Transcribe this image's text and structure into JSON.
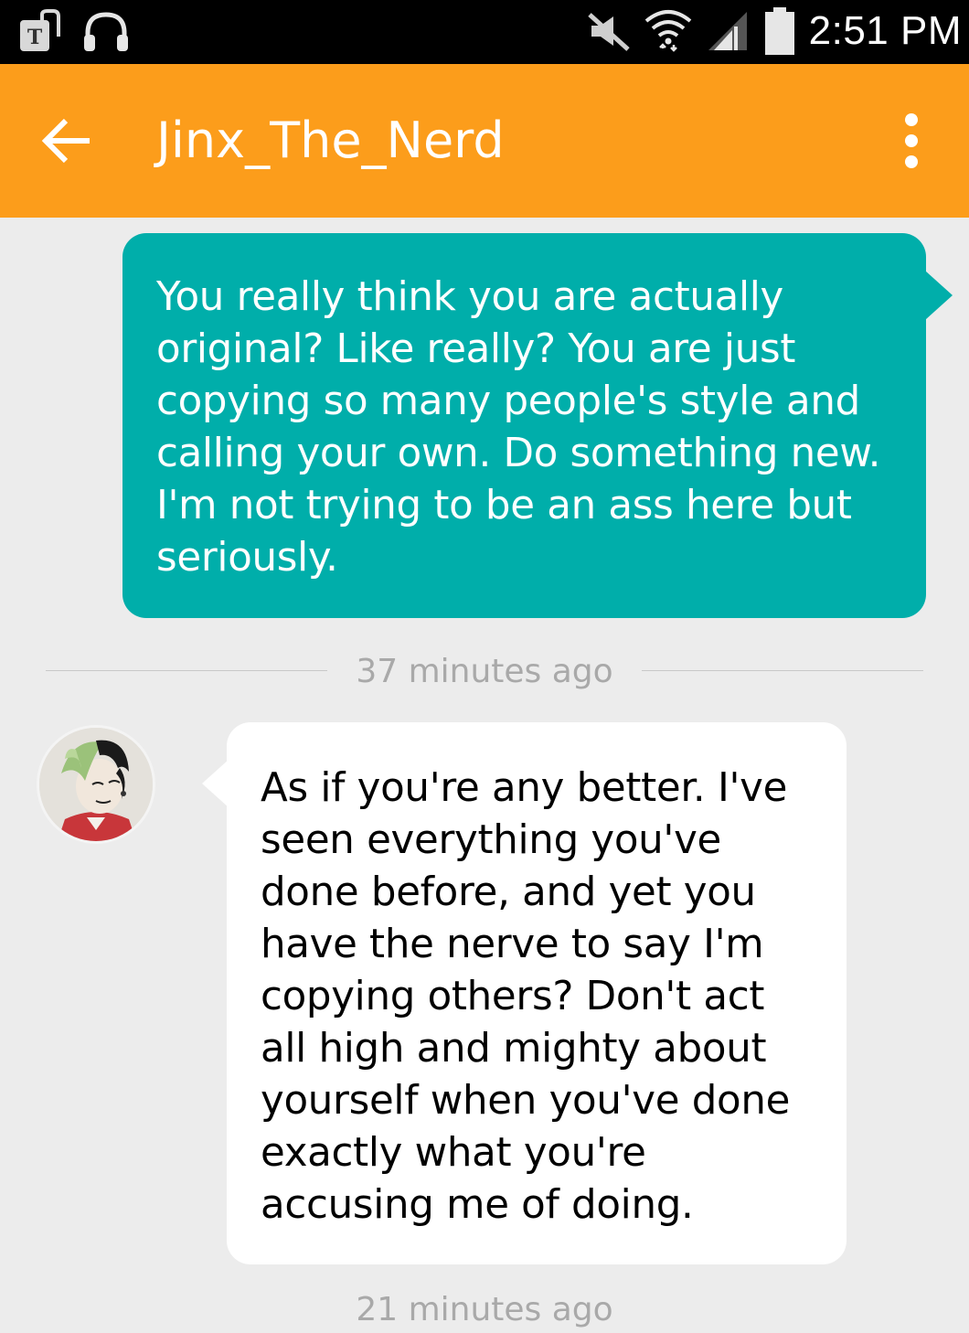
{
  "status_bar": {
    "time": "2:51 PM",
    "icons": [
      "carrier-badge-icon",
      "headphones-icon",
      "mute-icon",
      "wifi-icon",
      "signal-icon",
      "battery-icon"
    ]
  },
  "app_bar": {
    "title": "Jinx_The_Nerd",
    "back_icon": "back-arrow-icon",
    "menu_icon": "overflow-menu-icon",
    "background_color": "#fc9d1b"
  },
  "conversation": {
    "messages": [
      {
        "direction": "outgoing",
        "bubble_color": "#00aeaa",
        "text": "You really think you are actually original? Like really? You are just copying so many people's style and calling your own. Do something new. I'm not trying to be an ass here but seriously."
      },
      {
        "direction": "incoming",
        "bubble_color": "#ffffff",
        "text": "As if you're any better. I've seen everything you've done before, and yet you have the nerve to say I'm copying others? Don't act all high and mighty about yourself when you've done exactly what you're accusing me of doing."
      }
    ],
    "timestamps": [
      "37 minutes ago",
      "21 minutes ago"
    ]
  }
}
